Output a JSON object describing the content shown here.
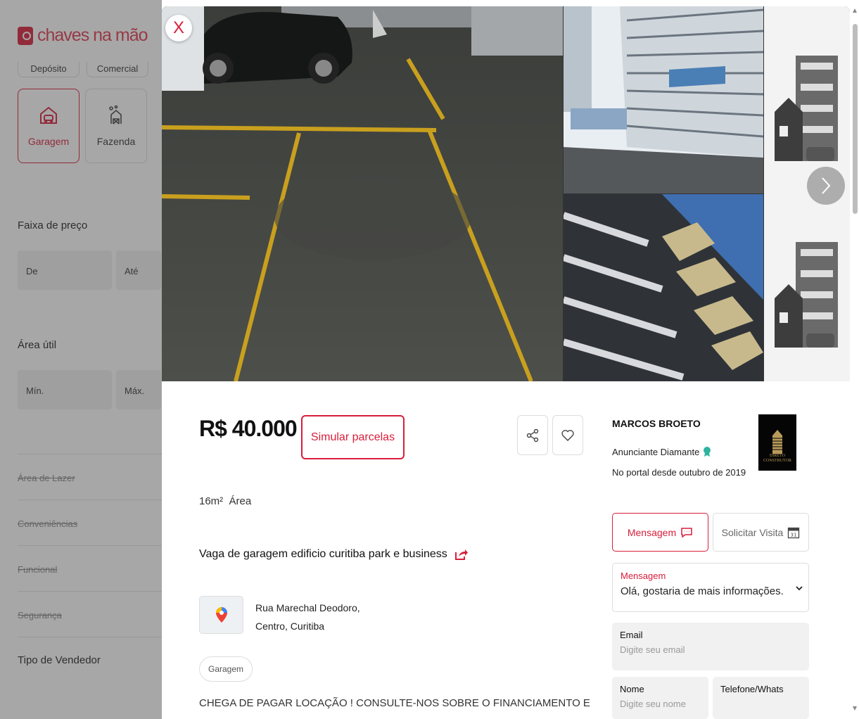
{
  "brand": {
    "name": "chaves na mão"
  },
  "sidebar": {
    "top_categories": [
      "Depósito",
      "Comercial"
    ],
    "categories": [
      {
        "label": "Garagem",
        "active": true
      },
      {
        "label": "Fazenda",
        "active": false
      }
    ],
    "price_range": {
      "label": "Faixa de preço",
      "from": "De",
      "to": "Até"
    },
    "area": {
      "label": "Área útil",
      "min": "Mín.",
      "max": "Máx."
    },
    "collapsed_sections": [
      "Área de Lazer",
      "Conveniências",
      "Funcional",
      "Segurança"
    ],
    "seller_type": "Tipo de Vendedor"
  },
  "modal": {
    "close_icon": "X",
    "price": "R$ 40.000",
    "simulate_label": "Simular parcelas",
    "area_value": "16m²",
    "area_label": "Área",
    "title": "Vaga de garagem edificio curitiba park e business",
    "address_line1": "Rua Marechal Deodoro,",
    "address_line2": "Centro, Curitiba",
    "tag": "Garagem",
    "description": "CHEGA DE PAGAR LOCAÇÃO ! CONSULTE-NOS SOBRE O FINANCIAMENTO E",
    "agent": {
      "name": "MARCOS BROETO",
      "badge": "Anunciante Diamante",
      "since": "No portal desde outubro de 2019",
      "logo_text": "DIRETO CONSTRUTOR"
    },
    "contact": {
      "message_button": "Mensagem",
      "visit_button": "Solicitar Visita",
      "calendar_day": "31",
      "message_field_label": "Mensagem",
      "message_field_value": "Olá, gostaria de mais informações.",
      "email_label": "Email",
      "email_placeholder": "Digite seu email",
      "name_label": "Nome",
      "name_placeholder": "Digite seu nome",
      "phone_label": "Telefone/Whats"
    }
  },
  "colors": {
    "accent": "#d81e3a"
  }
}
